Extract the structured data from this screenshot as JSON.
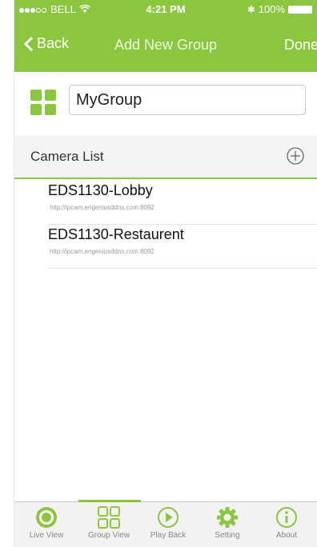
{
  "status_bar": {
    "carrier": "BELL",
    "time": "4:21 PM",
    "battery": "100%"
  },
  "nav": {
    "back_label": "Back",
    "title": "Add New Group",
    "done_label": "Done"
  },
  "group": {
    "name_value": "MyGroup"
  },
  "camera_list": {
    "title": "Camera List",
    "items": [
      {
        "name": "EDS1130-Lobby",
        "url": "http://ipcam.engeniusddns.com:8092"
      },
      {
        "name": "EDS1130-Restaurent",
        "url": "http://ipcam.engeniusddns.com:8092"
      }
    ]
  },
  "tabs": [
    {
      "label": "Live View",
      "icon": "live-view-icon"
    },
    {
      "label": "Group View",
      "icon": "group-view-icon"
    },
    {
      "label": "Play Back",
      "icon": "play-back-icon"
    },
    {
      "label": "Setting",
      "icon": "gear-icon"
    },
    {
      "label": "About",
      "icon": "info-icon"
    }
  ],
  "colors": {
    "accent": "#8cc63f",
    "tab_bar": "#f2f2f2"
  }
}
